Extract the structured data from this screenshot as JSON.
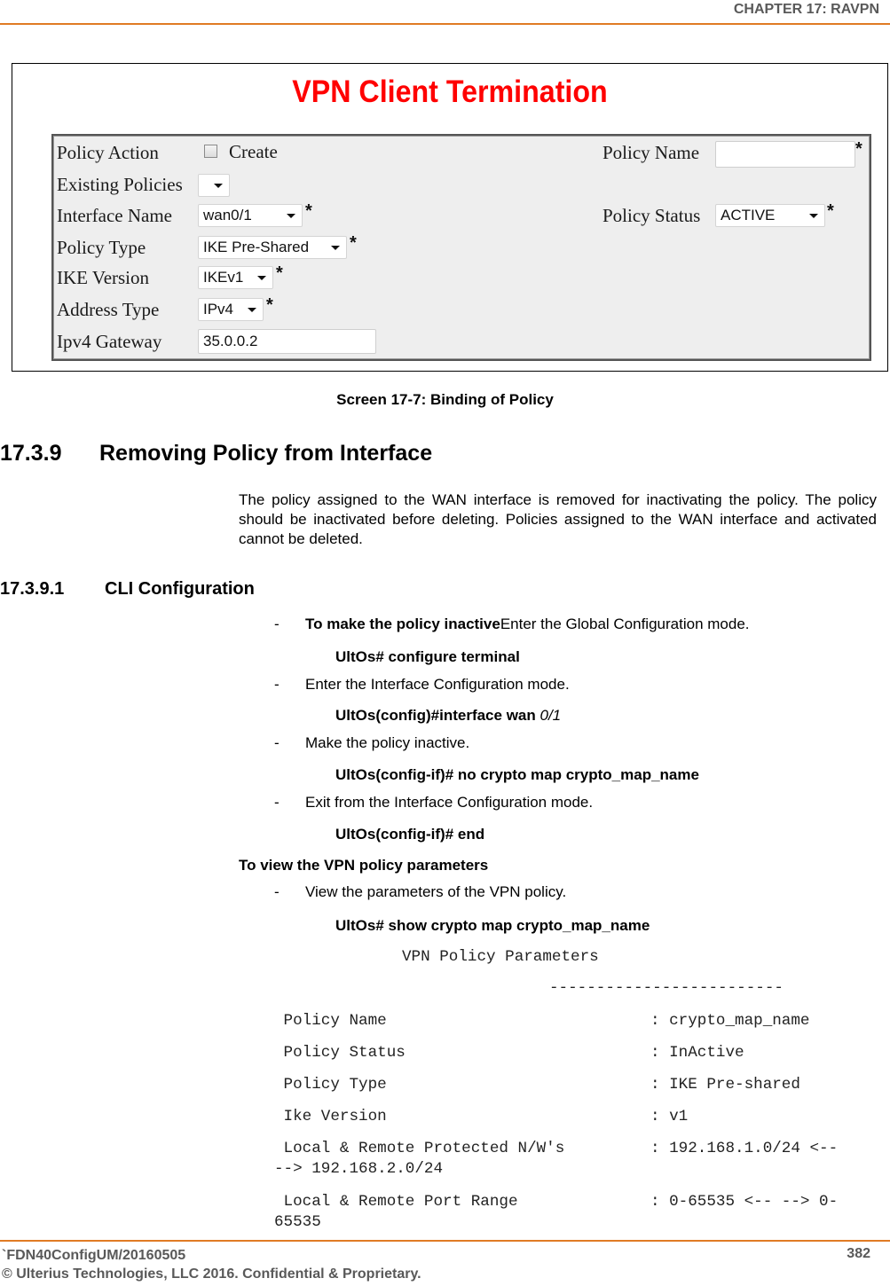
{
  "header": {
    "chapter": "CHAPTER 17: RAVPN"
  },
  "screenshot": {
    "title": "VPN Client Termination",
    "form": {
      "policy_action": {
        "label": "Policy Action",
        "checkbox_label": "Create",
        "checked": false
      },
      "existing_policies": {
        "label": "Existing Policies",
        "value": ""
      },
      "interface_name": {
        "label": "Interface Name",
        "value": "wan0/1",
        "required": "*"
      },
      "policy_type": {
        "label": "Policy Type",
        "value": "IKE Pre-Shared",
        "required": "*"
      },
      "ike_version": {
        "label": "IKE Version",
        "value": "IKEv1",
        "required": "*"
      },
      "address_type": {
        "label": "Address Type",
        "value": "IPv4",
        "required": "*"
      },
      "ipv4_gateway": {
        "label": "Ipv4 Gateway",
        "value": "35.0.0.2"
      },
      "policy_name": {
        "label": "Policy Name",
        "value": "",
        "required": "*"
      },
      "policy_status": {
        "label": "Policy Status",
        "value": "ACTIVE",
        "required": "*"
      }
    }
  },
  "caption": "Screen 17-7: Binding of Policy",
  "section": {
    "number": "17.3.9",
    "title": "Removing Policy from Interface",
    "paragraph": "The policy assigned to the WAN interface is removed for inactivating the policy. The policy should be inactivated before deleting. Policies assigned to the WAN interface and activated cannot be deleted."
  },
  "subsection": {
    "number": "17.3.9.1",
    "title": "CLI Configuration",
    "steps": [
      {
        "dash": "-",
        "bold_lead": "To make the policy inactive",
        "text": "Enter the Global Configuration mode.",
        "command": "UltOs# configure terminal"
      },
      {
        "dash": "-",
        "text": "Enter the Interface Configuration mode.",
        "command": "UltOs(config)#interface wan ",
        "command_italic": "0/1"
      },
      {
        "dash": "-",
        "text": "Make the policy inactive.",
        "command": "UltOs(config-if)# no crypto map crypto_map_name"
      },
      {
        "dash": "-",
        "text": "Exit from the Interface Configuration mode.",
        "command": "UltOs(config-if)# end"
      }
    ],
    "view_heading": "To view the VPN policy parameters",
    "view_step": {
      "dash": "-",
      "text": "View the parameters of the VPN policy.",
      "command": "UltOs# show crypto map crypto_map_name"
    },
    "output": {
      "title": "VPN Policy Parameters",
      "separator": "-------------------------",
      "rows": [
        {
          "key": " Policy Name",
          "value": ": crypto_map_name"
        },
        {
          "key": " Policy Status",
          "value": ": InActive"
        },
        {
          "key": " Policy Type",
          "value": ": IKE Pre-shared"
        },
        {
          "key": " Ike Version",
          "value": ": v1"
        },
        {
          "key": " Local & Remote Protected N/W's",
          "value": ": 192.168.1.0/24 <--",
          "wrap": "--> 192.168.2.0/24"
        },
        {
          "key": " Local & Remote Port Range",
          "value": ": 0-65535 <-- --> 0-",
          "wrap": "65535"
        }
      ]
    }
  },
  "footer": {
    "doc_id": "`FDN40ConfigUM/20160505",
    "copyright": "© Ulterius Technologies, LLC 2016. Confidential & Proprietary.",
    "page": "382"
  }
}
